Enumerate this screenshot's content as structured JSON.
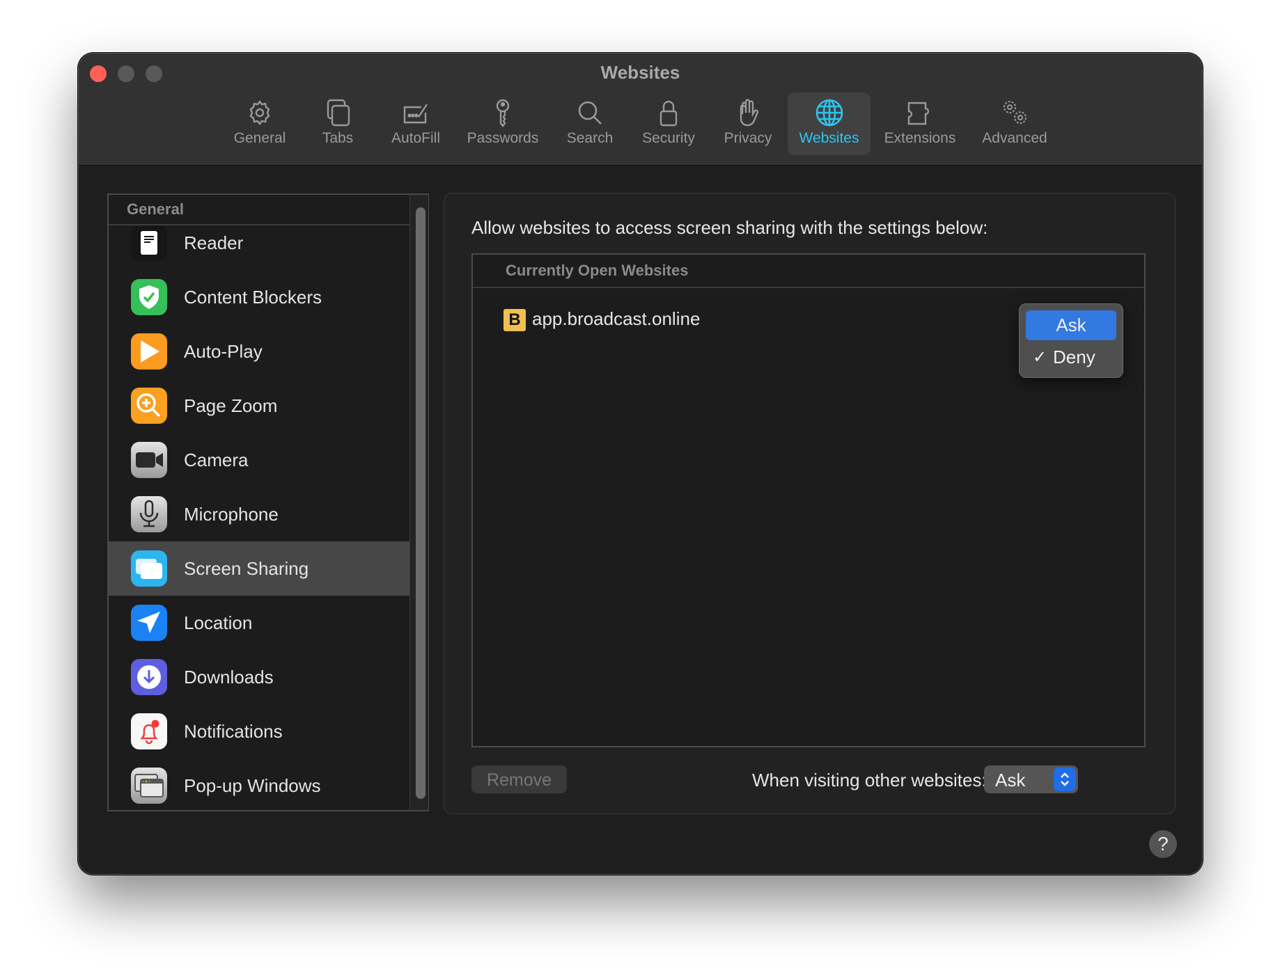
{
  "window": {
    "title": "Websites"
  },
  "toolbar": {
    "items": [
      {
        "label": "General",
        "icon": "gear-icon"
      },
      {
        "label": "Tabs",
        "icon": "tabs-icon"
      },
      {
        "label": "AutoFill",
        "icon": "autofill-icon"
      },
      {
        "label": "Passwords",
        "icon": "key-icon"
      },
      {
        "label": "Search",
        "icon": "search-icon"
      },
      {
        "label": "Security",
        "icon": "lock-icon"
      },
      {
        "label": "Privacy",
        "icon": "hand-icon"
      },
      {
        "label": "Websites",
        "icon": "globe-icon",
        "active": true
      },
      {
        "label": "Extensions",
        "icon": "puzzle-icon"
      },
      {
        "label": "Advanced",
        "icon": "gears-icon"
      }
    ],
    "active_color": "#2ec4f0"
  },
  "sidebar": {
    "section_header": "General",
    "items": [
      {
        "label": "Reader",
        "icon": "reader-icon"
      },
      {
        "label": "Content Blockers",
        "icon": "shield-check-icon"
      },
      {
        "label": "Auto-Play",
        "icon": "play-icon"
      },
      {
        "label": "Page Zoom",
        "icon": "zoom-icon"
      },
      {
        "label": "Camera",
        "icon": "camera-icon"
      },
      {
        "label": "Microphone",
        "icon": "microphone-icon"
      },
      {
        "label": "Screen Sharing",
        "icon": "screen-sharing-icon",
        "selected": true
      },
      {
        "label": "Location",
        "icon": "location-icon"
      },
      {
        "label": "Downloads",
        "icon": "download-icon"
      },
      {
        "label": "Notifications",
        "icon": "bell-icon"
      },
      {
        "label": "Pop-up Windows",
        "icon": "popup-windows-icon"
      }
    ]
  },
  "main": {
    "heading": "Allow websites to access screen sharing with the settings below:",
    "table": {
      "column_header": "Currently Open Websites",
      "rows": [
        {
          "favicon_letter": "B",
          "site": "app.broadcast.online",
          "setting": "Deny"
        }
      ]
    },
    "open_menu": {
      "options": [
        {
          "label": "Ask",
          "highlighted": true,
          "checked": false
        },
        {
          "label": "Deny",
          "highlighted": false,
          "checked": true
        }
      ],
      "check_glyph": "✓"
    },
    "remove_button": "Remove",
    "other_sites_label": "When visiting other websites:",
    "other_sites_value": "Ask",
    "help_label": "?"
  }
}
